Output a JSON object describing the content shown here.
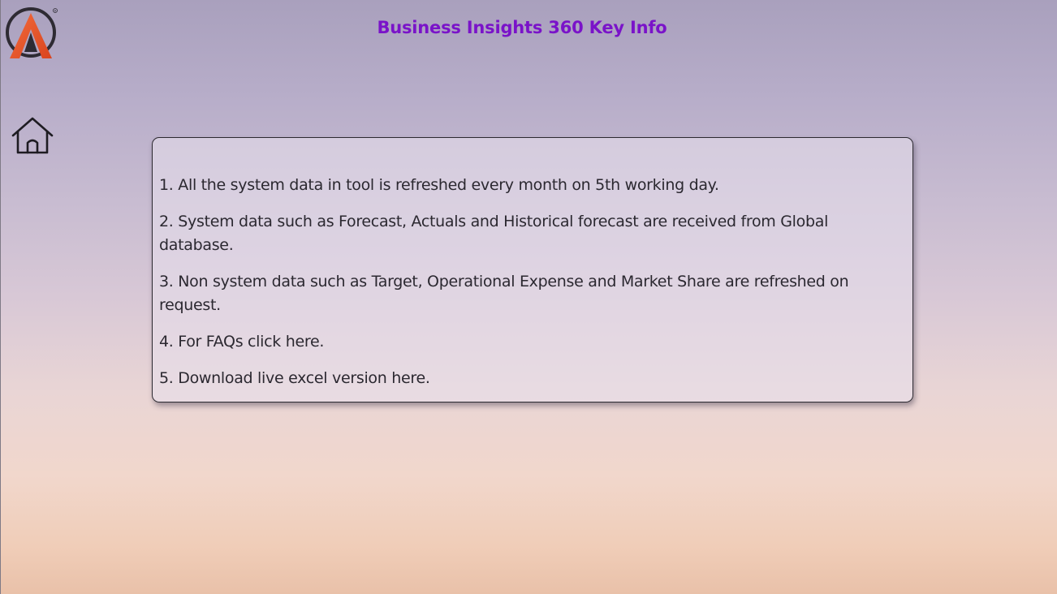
{
  "header": {
    "title": "Business Insights 360 Key Info",
    "logo_icon": "brand-logo-icon",
    "home_icon": "home-icon"
  },
  "info": {
    "items": [
      {
        "text": "1. All the system data in tool is refreshed every month on 5th working day."
      },
      {
        "text": "2.  System data such as Forecast, Actuals and Historical forecast are received from Global database."
      },
      {
        "text": "3.  Non system data such as Target, Operational Expense and Market Share are refreshed on request."
      },
      {
        "text": "4. For FAQs click here."
      },
      {
        "text": "5. Download live excel version here."
      }
    ]
  },
  "colors": {
    "title": "#7a13c9",
    "text": "#2b2830",
    "card_border": "#2c2930"
  }
}
